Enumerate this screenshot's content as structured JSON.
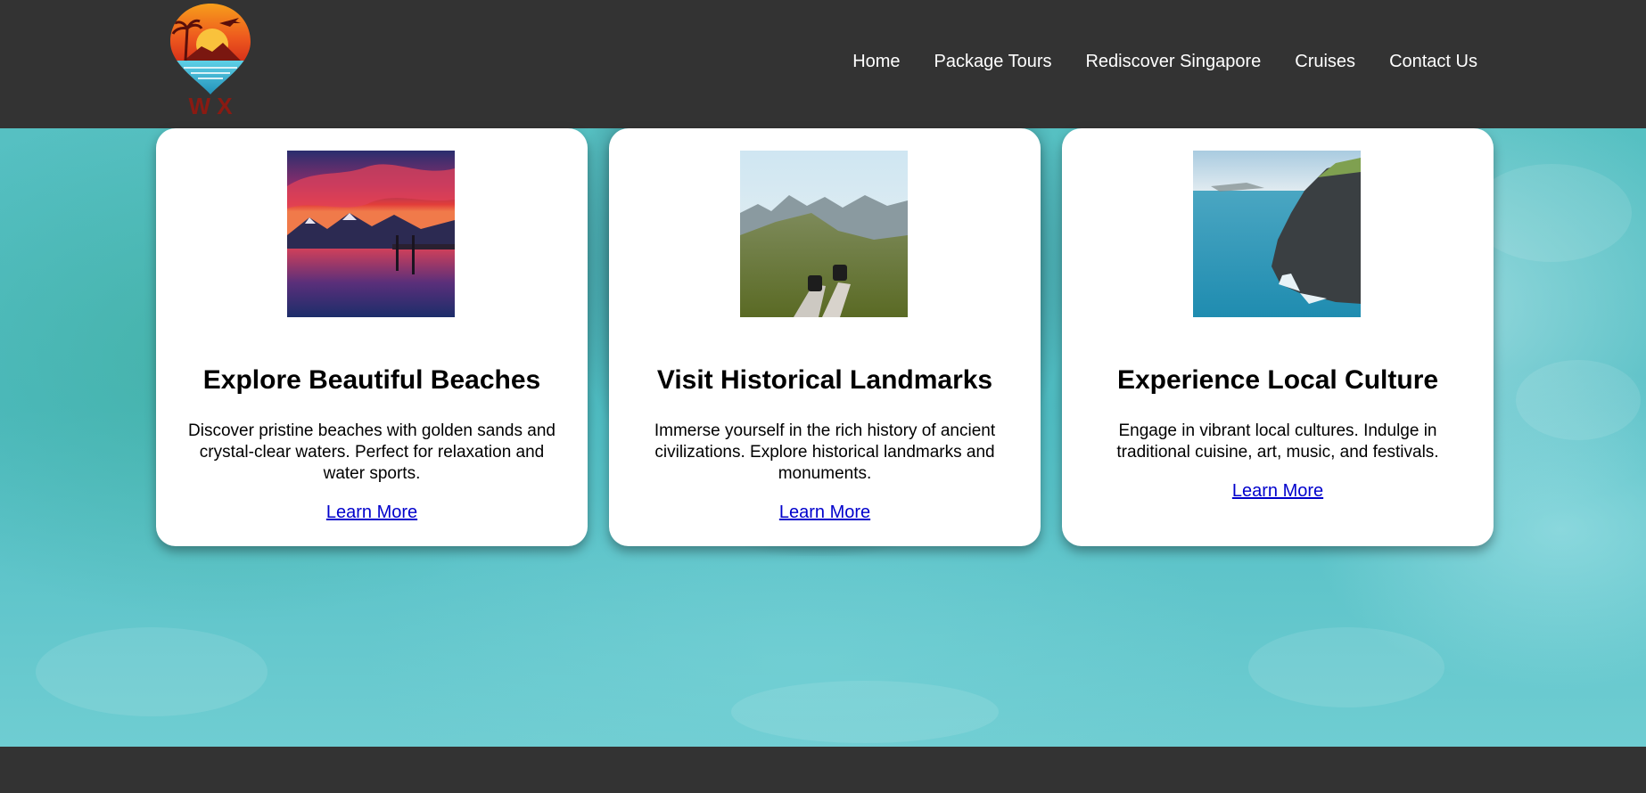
{
  "brand": {
    "logo_text": "W X"
  },
  "nav": {
    "items": [
      {
        "label": "Home"
      },
      {
        "label": "Package Tours"
      },
      {
        "label": "Rediscover Singapore"
      },
      {
        "label": "Cruises"
      },
      {
        "label": "Contact Us"
      }
    ]
  },
  "cards": [
    {
      "title": "Explore Beautiful Beaches",
      "description": "Discover pristine beaches with golden sands and crystal-clear waters. Perfect for relaxation and water sports.",
      "link": "Learn More",
      "image": "mountain-lake-sunset-photo"
    },
    {
      "title": "Visit Historical Landmarks",
      "description": "Immerse yourself in the rich history of ancient civilizations. Explore historical landmarks and monuments.",
      "link": "Learn More",
      "image": "mountain-view-legs-photo"
    },
    {
      "title": "Experience Local Culture",
      "description": "Engage in vibrant local cultures. Indulge in traditional cuisine, art, music, and festivals.",
      "link": "Learn More",
      "image": "coastal-cliffs-photo"
    }
  ],
  "colors": {
    "header_bg": "#333333",
    "footer_bg": "#333333",
    "nav_text": "#ffffff",
    "link": "#0000cc",
    "water": "#56c0c2"
  }
}
